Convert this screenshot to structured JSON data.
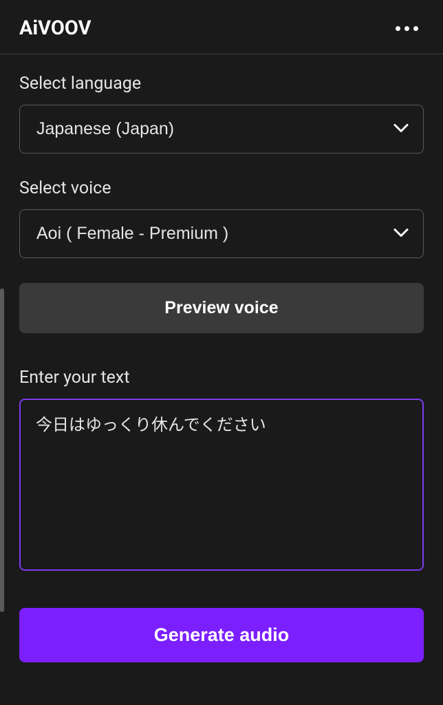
{
  "header": {
    "title": "AiVOOV"
  },
  "fields": {
    "language": {
      "label": "Select language",
      "value": "Japanese (Japan)"
    },
    "voice": {
      "label": "Select voice",
      "value": "Aoi ( Female - Premium )"
    },
    "previewLabel": "Preview voice",
    "text": {
      "label": "Enter your text",
      "value": "今日はゆっくり休んでください"
    },
    "generateLabel": "Generate audio"
  }
}
